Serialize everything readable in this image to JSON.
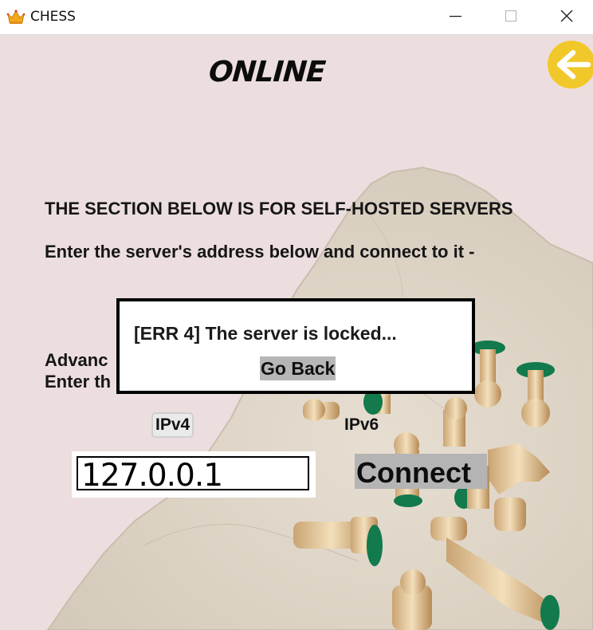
{
  "window": {
    "title": "CHESS",
    "app_icon": "crown-icon",
    "controls": [
      "minimize-icon",
      "maximize-icon",
      "close-icon"
    ]
  },
  "page": {
    "heading": "ONLINE",
    "back_icon": "back-arrow-icon",
    "section_heading": "THE SECTION BELOW IS FOR SELF-HOSTED SERVERS",
    "address_instruction": "Enter the server's address below and connect to it -",
    "advanced_line_1": "Advanc",
    "advanced_line_2": "Enter th",
    "ip_modes": {
      "ipv4": "IPv4",
      "ipv6": "IPv6",
      "selected": "ipv4"
    },
    "address_value": "127.0.0.1",
    "connect_label": "Connect"
  },
  "dialog": {
    "message": "[ERR 4] The server is locked...",
    "go_back_label": "Go Back"
  },
  "colors": {
    "background": "#ecdedf",
    "marble": "#ded5c6",
    "back_button": "#f1c82a",
    "felt_green": "#127a4c",
    "button_gray": "#b4b4b4"
  }
}
